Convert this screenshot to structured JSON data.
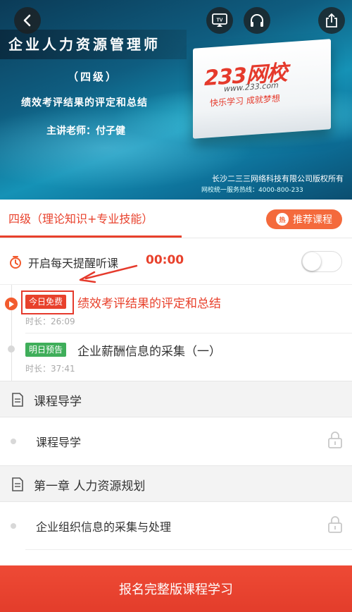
{
  "banner": {
    "course_title": "企业人力资源管理师",
    "level": "（四级）",
    "lesson_title": "绩效考评结果的评定和总结",
    "teacher": "主讲老师：付子健",
    "brand": "233网校",
    "brand_url": "www.233.com",
    "slogan": "快乐学习  成就梦想",
    "copyright": "长沙二三三网络科技有限公司版权所有",
    "hotline": "网校统一服务热线：4000-800-233",
    "tv_label": "TV"
  },
  "icons": {
    "back": "chevron-left-icon",
    "tv": "tv-cast-icon",
    "audio": "headphones-icon",
    "share": "share-icon"
  },
  "course_tab": {
    "label": "四级（理论知识+专业技能）",
    "recommend_label": "推荐课程",
    "recommend_icon_text": "热"
  },
  "reminder": {
    "label": "开启每天提醒听课",
    "time": "00:00",
    "enabled": false
  },
  "lessons": [
    {
      "badge": "今日免费",
      "badge_color": "#e8412c",
      "title": "绩效考评结果的评定和总结",
      "duration": "时长：26:09",
      "playing": true
    },
    {
      "badge": "明日预告",
      "badge_color": "#3fae5a",
      "title": "企业薪酬信息的采集（一）",
      "duration": "时长：37:41",
      "playing": false
    }
  ],
  "sections": [
    {
      "title": "课程导学",
      "items": [
        {
          "title": "课程导学",
          "locked": true
        }
      ]
    },
    {
      "title": "第一章 人力资源规划",
      "items": [
        {
          "title": "企业组织信息的采集与处理",
          "locked": true
        }
      ]
    }
  ],
  "cta": {
    "label": "报名完整版课程学习"
  },
  "colors": {
    "accent": "#e8412c",
    "free_badge": "#e8412c",
    "preview_badge": "#3fae5a",
    "recommend_button": "#f46a3c"
  }
}
